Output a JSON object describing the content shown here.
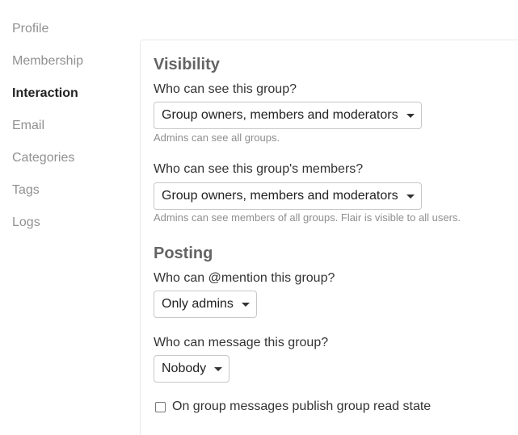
{
  "sidebar": {
    "items": [
      {
        "label": "Profile",
        "active": false
      },
      {
        "label": "Membership",
        "active": false
      },
      {
        "label": "Interaction",
        "active": true
      },
      {
        "label": "Email",
        "active": false
      },
      {
        "label": "Categories",
        "active": false
      },
      {
        "label": "Tags",
        "active": false
      },
      {
        "label": "Logs",
        "active": false
      }
    ]
  },
  "visibility": {
    "title": "Visibility",
    "group_visibility": {
      "label": "Who can see this group?",
      "value": "Group owners, members and moderators",
      "help": "Admins can see all groups."
    },
    "members_visibility": {
      "label": "Who can see this group's members?",
      "value": "Group owners, members and moderators",
      "help": "Admins can see members of all groups. Flair is visible to all users."
    }
  },
  "posting": {
    "title": "Posting",
    "mention": {
      "label": "Who can @mention this group?",
      "value": "Only admins"
    },
    "message": {
      "label": "Who can message this group?",
      "value": "Nobody"
    },
    "read_state": {
      "label": "On group messages publish group read state",
      "checked": false
    }
  }
}
